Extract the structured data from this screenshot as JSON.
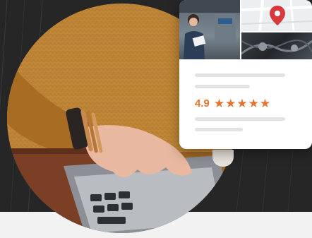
{
  "review_card": {
    "rating": "4.9",
    "stars": [
      "★",
      "★",
      "★",
      "★",
      "★"
    ],
    "star_color": "#e8732b",
    "map_pin_icon": "map-pin-icon"
  },
  "colors": {
    "background": "#262626",
    "card": "#ffffff",
    "accent": "#e8732b",
    "bottom_strip": "#f2f2f2"
  }
}
